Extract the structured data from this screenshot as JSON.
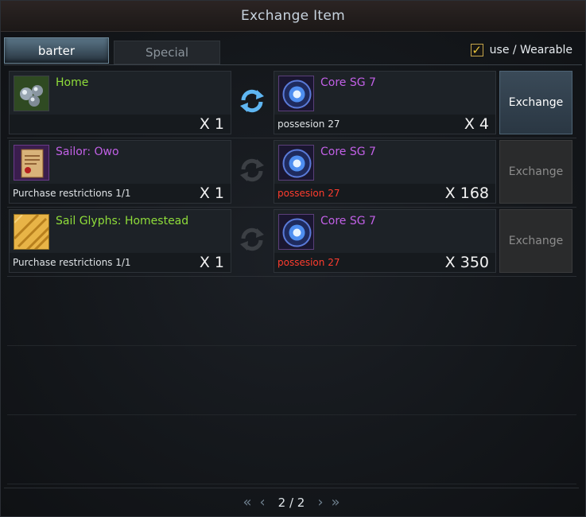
{
  "window": {
    "title": "Exchange Item"
  },
  "tabs": [
    {
      "label": "barter",
      "active": true
    },
    {
      "label": "Special",
      "active": false
    }
  ],
  "filter": {
    "label": "use / Wearable",
    "checked": true,
    "check_mark": "✓"
  },
  "rows": [
    {
      "offer": {
        "name": "Home",
        "name_color": "green",
        "qty": "X 1",
        "sub": "",
        "icon": "silver-pearls-icon"
      },
      "cost": {
        "name": "Core SG 7",
        "qty": "X 4",
        "sub": "possesion 27",
        "sub_color": "white",
        "icon": "blue-orb-icon"
      },
      "button": {
        "label": "Exchange",
        "enabled": true
      }
    },
    {
      "offer": {
        "name": "Sailor: Owo",
        "name_color": "purple",
        "qty": "X 1",
        "sub": "Purchase restrictions 1/1",
        "icon": "scroll-icon"
      },
      "cost": {
        "name": "Core SG 7",
        "qty": "X 168",
        "sub": "possesion 27",
        "sub_color": "red",
        "icon": "blue-orb-icon"
      },
      "button": {
        "label": "Exchange",
        "enabled": false
      }
    },
    {
      "offer": {
        "name": "Sail Glyphs: Homestead",
        "name_color": "green",
        "qty": "X 1",
        "sub": "Purchase restrictions 1/1",
        "icon": "gold-glyph-icon"
      },
      "cost": {
        "name": "Core SG 7",
        "qty": "X 350",
        "sub": "possesion 27",
        "sub_color": "red",
        "icon": "blue-orb-icon"
      },
      "button": {
        "label": "Exchange",
        "enabled": false
      }
    }
  ],
  "pagination": {
    "text": "2 / 2"
  },
  "colors": {
    "green": "#8fdd3a",
    "purple": "#c160e6",
    "red": "#ff3c2e",
    "accent": "#6d8899",
    "check": "#e9c53a"
  }
}
